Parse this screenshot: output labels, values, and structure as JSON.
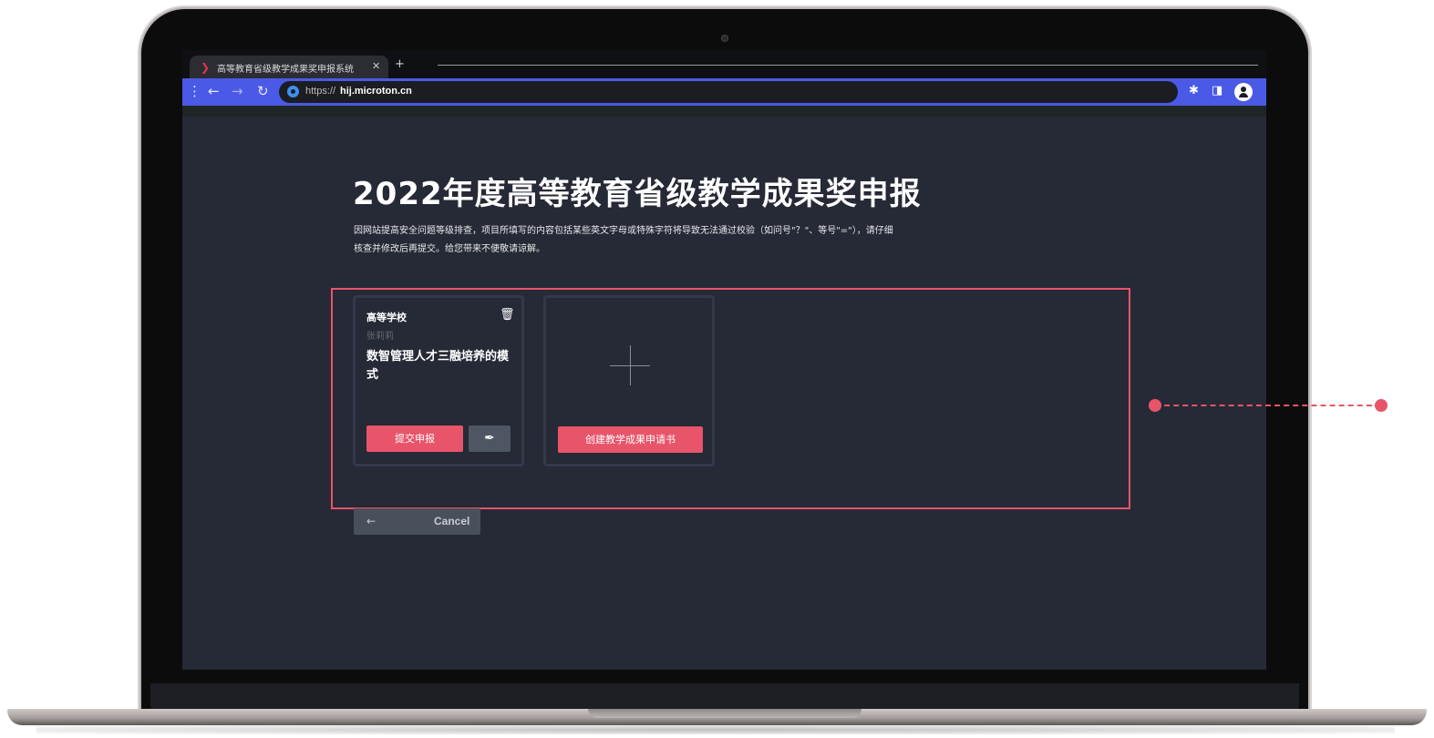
{
  "browser": {
    "tab_title": "高等教育省级教学成果奖申报系统",
    "tab_close": "✕",
    "new_tab": "+",
    "url_scheme": "https://",
    "url_host": "hij.microton.cn"
  },
  "page": {
    "title": "2022年度高等教育省级教学成果奖申报",
    "notice": "因网站提高安全问题等级排查，项目所填写的内容包括某些英文字母或特殊字符将导致无法通过校验（如问号\"？\"、等号\"=\"），请仔细核查并修改后再提交。给您带来不便敬请谅解。"
  },
  "cards": [
    {
      "school": "高等学校",
      "author": "张莉莉",
      "project": "数智管理人才三融培养的模式",
      "submit_label": "提交申报"
    }
  ],
  "create_card": {
    "create_label": "创建教学成果申请书"
  },
  "footer": {
    "cancel_arrow": "←",
    "cancel_label": "Cancel"
  },
  "colors": {
    "accent": "#e8546a",
    "toolbar": "#4a5ae6",
    "page_bg": "#262936"
  },
  "icons": {
    "trash": "trash-icon",
    "edit": "quill-pen-icon",
    "plus": "plus-icon"
  }
}
